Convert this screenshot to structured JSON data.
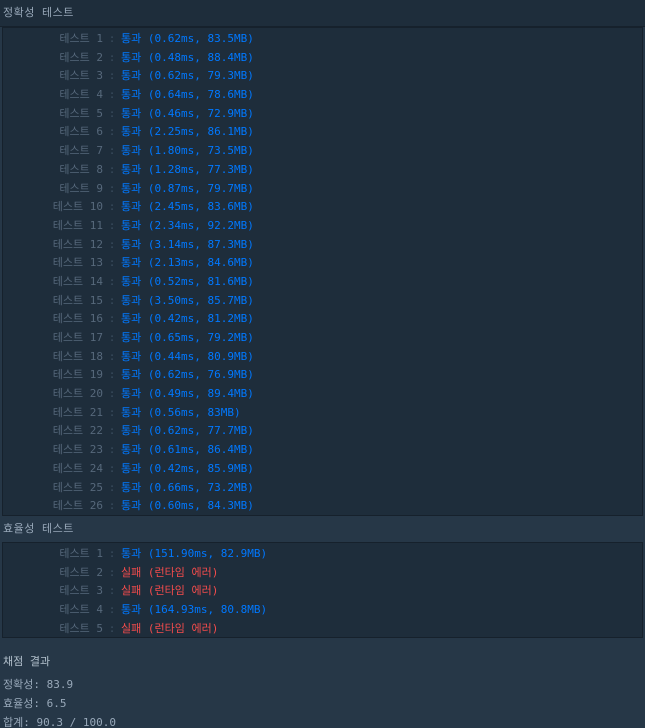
{
  "accuracy": {
    "header": "정확성  테스트",
    "rows": [
      {
        "label": "테스트 1",
        "status": "통과",
        "detail": "(0.62ms, 83.5MB)",
        "pass": true
      },
      {
        "label": "테스트 2",
        "status": "통과",
        "detail": "(0.48ms, 88.4MB)",
        "pass": true
      },
      {
        "label": "테스트 3",
        "status": "통과",
        "detail": "(0.62ms, 79.3MB)",
        "pass": true
      },
      {
        "label": "테스트 4",
        "status": "통과",
        "detail": "(0.64ms, 78.6MB)",
        "pass": true
      },
      {
        "label": "테스트 5",
        "status": "통과",
        "detail": "(0.46ms, 72.9MB)",
        "pass": true
      },
      {
        "label": "테스트 6",
        "status": "통과",
        "detail": "(2.25ms, 86.1MB)",
        "pass": true
      },
      {
        "label": "테스트 7",
        "status": "통과",
        "detail": "(1.80ms, 73.5MB)",
        "pass": true
      },
      {
        "label": "테스트 8",
        "status": "통과",
        "detail": "(1.28ms, 77.3MB)",
        "pass": true
      },
      {
        "label": "테스트 9",
        "status": "통과",
        "detail": "(0.87ms, 79.7MB)",
        "pass": true
      },
      {
        "label": "테스트 10",
        "status": "통과",
        "detail": "(2.45ms, 83.6MB)",
        "pass": true
      },
      {
        "label": "테스트 11",
        "status": "통과",
        "detail": "(2.34ms, 92.2MB)",
        "pass": true
      },
      {
        "label": "테스트 12",
        "status": "통과",
        "detail": "(3.14ms, 87.3MB)",
        "pass": true
      },
      {
        "label": "테스트 13",
        "status": "통과",
        "detail": "(2.13ms, 84.6MB)",
        "pass": true
      },
      {
        "label": "테스트 14",
        "status": "통과",
        "detail": "(0.52ms, 81.6MB)",
        "pass": true
      },
      {
        "label": "테스트 15",
        "status": "통과",
        "detail": "(3.50ms, 85.7MB)",
        "pass": true
      },
      {
        "label": "테스트 16",
        "status": "통과",
        "detail": "(0.42ms, 81.2MB)",
        "pass": true
      },
      {
        "label": "테스트 17",
        "status": "통과",
        "detail": "(0.65ms, 79.2MB)",
        "pass": true
      },
      {
        "label": "테스트 18",
        "status": "통과",
        "detail": "(0.44ms, 80.9MB)",
        "pass": true
      },
      {
        "label": "테스트 19",
        "status": "통과",
        "detail": "(0.62ms, 76.9MB)",
        "pass": true
      },
      {
        "label": "테스트 20",
        "status": "통과",
        "detail": "(0.49ms, 89.4MB)",
        "pass": true
      },
      {
        "label": "테스트 21",
        "status": "통과",
        "detail": "(0.56ms, 83MB)",
        "pass": true
      },
      {
        "label": "테스트 22",
        "status": "통과",
        "detail": "(0.62ms, 77.7MB)",
        "pass": true
      },
      {
        "label": "테스트 23",
        "status": "통과",
        "detail": "(0.61ms, 86.4MB)",
        "pass": true
      },
      {
        "label": "테스트 24",
        "status": "통과",
        "detail": "(0.42ms, 85.9MB)",
        "pass": true
      },
      {
        "label": "테스트 25",
        "status": "통과",
        "detail": "(0.66ms, 73.2MB)",
        "pass": true
      },
      {
        "label": "테스트 26",
        "status": "통과",
        "detail": "(0.60ms, 84.3MB)",
        "pass": true
      }
    ]
  },
  "efficiency": {
    "header": "효율성  테스트",
    "rows": [
      {
        "label": "테스트 1",
        "status": "통과",
        "detail": "(151.90ms, 82.9MB)",
        "pass": true
      },
      {
        "label": "테스트 2",
        "status": "실패",
        "detail": "(런타임 에러)",
        "pass": false
      },
      {
        "label": "테스트 3",
        "status": "실패",
        "detail": "(런타임 에러)",
        "pass": false
      },
      {
        "label": "테스트 4",
        "status": "통과",
        "detail": "(164.93ms, 80.8MB)",
        "pass": true
      },
      {
        "label": "테스트 5",
        "status": "실패",
        "detail": "(런타임 에러)",
        "pass": false
      }
    ]
  },
  "result": {
    "title": "채점 결과",
    "accuracy": "정확성: 83.9",
    "efficiency": "효율성: 6.5",
    "total": "합계: 90.3 / 100.0"
  },
  "separator": ":",
  "colors": {
    "pass": "#0078ff",
    "fail": "#f44c4c",
    "background": "#263747",
    "panel": "#1e2d3b"
  }
}
